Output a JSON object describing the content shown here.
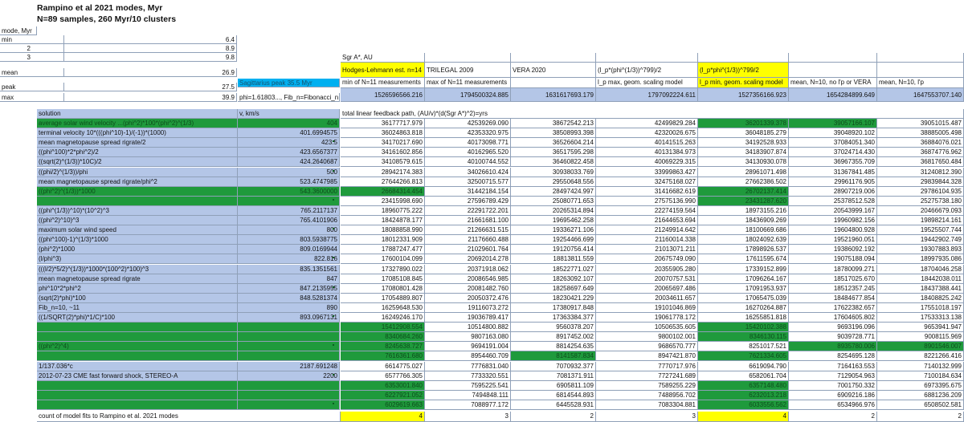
{
  "title": [
    "Rampino et al 2021 modes, Myr",
    "N=89 samples, 260 Myr/10 clusters"
  ],
  "modes": {
    "header": "mode, Myr",
    "rows": [
      {
        "label": "min",
        "idx": "",
        "value": "6.4"
      },
      {
        "label": "",
        "idx": "2",
        "value": "8.9"
      },
      {
        "label": "",
        "idx": "3",
        "value": "9.8"
      },
      {
        "label": "mean",
        "idx": "",
        "value": "26.9"
      },
      {
        "label": "peak",
        "idx": "",
        "value": "27.5"
      },
      {
        "label": "max",
        "idx": "",
        "value": "39.9"
      }
    ],
    "peak_note": "Sagittarius peak 35.5 Myr",
    "max_note": "phi=1.61803..., Fib_n=Fibonacci_n"
  },
  "columns": [
    {
      "c1": "Sgr A*, AU",
      "c2": "Hodges-Lehmann est. n=14",
      "c3": "min of N=11 measurements",
      "num": "1526596566.216"
    },
    {
      "c1": "",
      "c2": "TRILEGAL 2009",
      "c3": "max of N=11 measurements",
      "num": "1794500324.885"
    },
    {
      "c1": "",
      "c2": "VERA 2020",
      "c3": "",
      "num": "1631617693.179"
    },
    {
      "c1": "",
      "c2": "(l_p*(phi^(1/3))^799)/2",
      "c3": "l_p max, geom. scaling model",
      "num": "1797092224.611"
    },
    {
      "c1": "",
      "c2": "(l_p*phi^(1/3))^799/2",
      "c3": "l_p min, geom. scaling model",
      "num": "1527356166.923"
    },
    {
      "c1": "",
      "c2": "",
      "c3": "mean, N=10, no l'p or VERA",
      "num": "1654284899.649"
    },
    {
      "c1": "",
      "c2": "",
      "c3": "mean, N=10, l'p",
      "num": "1647553707.140"
    }
  ],
  "table": {
    "solution_header": "solution",
    "v_header": "v, km/s",
    "path_header": "total linear feedback path, (AU/v)*(d(Sgr A*)^2)=yrs",
    "footer_label": "count of model fits to Rampino et al. 2021 modes",
    "footer_counts": [
      "4",
      "3",
      "2",
      "3",
      "4",
      "2",
      "2"
    ],
    "rows": [
      {
        "label": "average solar wind velocity ...(phi^2)*100*(phi^2)^(1/3)",
        "v": "404",
        "vals": [
          "36177717.979",
          "42539269.090",
          "38672542.213",
          "42499829.284",
          "36201339.378",
          "39057166.107",
          "39051015.487"
        ]
      },
      {
        "label": "terminal velocity 10*(((phi^10)-1)/(-1))*(1000)",
        "v": "401.6994575",
        "vals": [
          "36024863.818",
          "42353320.975",
          "38508993.398",
          "42320026.675",
          "36048185.279",
          "39048920.102",
          "38885005.498"
        ]
      },
      {
        "label": "mean magnetopause spread rigrate/2",
        "v": "423.5",
        "vals": [
          "34170217.690",
          "40173098.771",
          "36526604.214",
          "40141515.263",
          "34192528.933",
          "37084051.340",
          "36884076.021"
        ]
      },
      {
        "label": "((phi^100)*2*phi^2)/2",
        "v": "423.6567377",
        "vals": [
          "34161602.856",
          "40162965.520",
          "36517595.298",
          "40131384.973",
          "34183907.874",
          "37024714.430",
          "36874776.962"
        ]
      },
      {
        "label": "((sqrt(2)^(1/3))*10C)/2",
        "v": "424.2640687",
        "vals": [
          "34108579.615",
          "40100744.552",
          "36460822.458",
          "40069229.315",
          "34130930.078",
          "36967355.709",
          "36817650.484"
        ]
      },
      {
        "label": "((phi/2)^(1/3))/phi",
        "v": "500",
        "vals": [
          "28942174.383",
          "34026610.424",
          "30938033.769",
          "33999863.427",
          "28961071.498",
          "31367841.485",
          "31240812.390"
        ]
      },
      {
        "label": "mean magnetopause spread rigrate/phi^2",
        "v": "523.4747985",
        "vals": [
          "27644266.813",
          "32500715.577",
          "29550648.556",
          "32475168.027",
          "27662386.502",
          "29961176.905",
          "29839844.328"
        ]
      },
      {
        "label": "((phi^2)^(1/3))*1000",
        "v": "543.3600000",
        "vals": [
          "26684314.454",
          "31442184.154",
          "28497424.997",
          "31416682.619",
          "26702137.414",
          "28907219.006",
          "29786104.935"
        ]
      },
      {
        "label": "",
        "v": "",
        "vals": [
          "23415998.690",
          "27596789.429",
          "25080771.653",
          "27575136.990",
          "23431287.620",
          "25378512.528",
          "25275738.180"
        ]
      },
      {
        "label": "((phi^(1/3))^10)*(10^2)^3",
        "v": "765.2117137",
        "vals": [
          "18960775.222",
          "22291722.201",
          "20265314.894",
          "22274159.564",
          "18973155.216",
          "20543999.167",
          "20466679.093"
        ]
      },
      {
        "label": "((phi^2)^10)^3",
        "v": "765.4101906",
        "vals": [
          "18424878.177",
          "21661681.100",
          "19695462.258",
          "21644653.694",
          "18436909.269",
          "19960982.156",
          "19898214.161"
        ]
      },
      {
        "label": "maximum solar wind speed",
        "v": "800",
        "vals": [
          "18088858.990",
          "21266631.515",
          "19336271.106",
          "21249914.642",
          "18100669.686",
          "19604800.928",
          "19525507.744"
        ]
      },
      {
        "label": "((phi^100)-1)^(1/3)*1000",
        "v": "803.5938775",
        "vals": [
          "18012331.909",
          "21176660.488",
          "19254466.699",
          "21160014.338",
          "18024092.639",
          "19521960.051",
          "19442902.749"
        ]
      },
      {
        "label": "(phi^2)*1000",
        "v": "809.0169944",
        "vals": [
          "17887247.477",
          "21029601.764",
          "19120756.414",
          "21013071.211",
          "17898926.537",
          "19386092.192",
          "19307883.893"
        ]
      },
      {
        "label": "(l/phi^3)",
        "v": "822.816",
        "vals": [
          "17600104.099",
          "20692014.278",
          "18813811.559",
          "20675749.090",
          "17611595.674",
          "19075188.094",
          "18997935.086"
        ]
      },
      {
        "label": "(((l/2)*5/2)^(1/3))*1000*(100^2)*100)^3",
        "v": "835.1351561",
        "vals": [
          "17327890.022",
          "20371918.062",
          "18522771.027",
          "20355905.280",
          "17339152.899",
          "18780099.271",
          "18704046.258"
        ]
      },
      {
        "label": "mean magnetopause spread rigrate",
        "v": "847",
        "vals": [
          "17085108.845",
          "20086546.985",
          "18263092.107",
          "20070757.531",
          "17096264.167",
          "18517025.670",
          "18442038.011"
        ]
      },
      {
        "label": "phi^10*2*phi^2",
        "v": "847.2135955",
        "vals": [
          "17080801.428",
          "20081482.760",
          "18258697.649",
          "20065697.486",
          "17091953.937",
          "18512357.245",
          "18437388.441"
        ]
      },
      {
        "label": "(sqrt(2)*phi)*100",
        "v": "848.5281374",
        "vals": [
          "17054889.807",
          "20050372.476",
          "18230421.229",
          "20034611.657",
          "17065475.039",
          "18484677.854",
          "18408825.242"
        ]
      },
      {
        "label": "Fib_n=10, ~11",
        "v": "890",
        "vals": [
          "16259648.530",
          "19116073.272",
          "17380917.848",
          "19101046.869",
          "16270264.887",
          "17622382.657",
          "17551018.197"
        ]
      },
      {
        "label": "((1/SQRT(2)*phi)*1/C)*100",
        "v": "893.0967131",
        "vals": [
          "16249246.170",
          "19036789.417",
          "17363384.377",
          "19061778.172",
          "16255851.818",
          "17604605.802",
          "17533313.138"
        ]
      },
      {
        "label": "",
        "v": "",
        "vals": [
          "15412908.554",
          "10514800.882",
          "9560378.207",
          "10506535.605",
          "15420102.388",
          "9693196.096",
          "9653941.947"
        ]
      },
      {
        "label": "",
        "v": "",
        "vals": [
          "8340684.260",
          "9807163.080",
          "8917452.002",
          "9800102.001",
          "8346130.115",
          "9039728.771",
          "9008115.969"
        ]
      },
      {
        "label": "((phi^2)^4)",
        "v": "",
        "vals": [
          "8245638.727",
          "9694191.004",
          "8814254.635",
          "9686570.777",
          "8251017.521",
          "8935780.006",
          "8901546.007"
        ]
      },
      {
        "label": "",
        "v": "",
        "vals": [
          "7616361.680",
          "8954460.709",
          "8141587.834",
          "8947421.870",
          "7621334.605",
          "8254695.128",
          "8221266.416"
        ]
      },
      {
        "label": "1/137.036*c",
        "v": "2187.691248",
        "vals": [
          "6614775.027",
          "7776831.040",
          "7070932.377",
          "7770717.976",
          "6619094.790",
          "7164163.553",
          "7140132.999"
        ]
      },
      {
        "label": "2012-07-23 CME fast forward shock, STEREO-A",
        "v": "2200",
        "vals": [
          "6577766.305",
          "7733320.551",
          "7081371.911",
          "7727241.689",
          "6582061.704",
          "7129054.963",
          "7100184.634"
        ]
      },
      {
        "label": "",
        "v": "",
        "vals": [
          "6353001.840",
          "7595225.541",
          "6905811.109",
          "7589255.229",
          "6357148.480",
          "7001750.332",
          "6973395.675"
        ]
      },
      {
        "label": "",
        "v": "",
        "vals": [
          "6227921.052",
          "7494848.111",
          "6814544.893",
          "7488956.702",
          "6232013.218",
          "6909216.186",
          "6881236.209"
        ]
      },
      {
        "label": "",
        "v": "",
        "vals": [
          "6029619.663",
          "7088977.172",
          "6445528.931",
          "7083304.881",
          "6033556.562",
          "6534966.976",
          "6508502.581"
        ]
      }
    ]
  }
}
